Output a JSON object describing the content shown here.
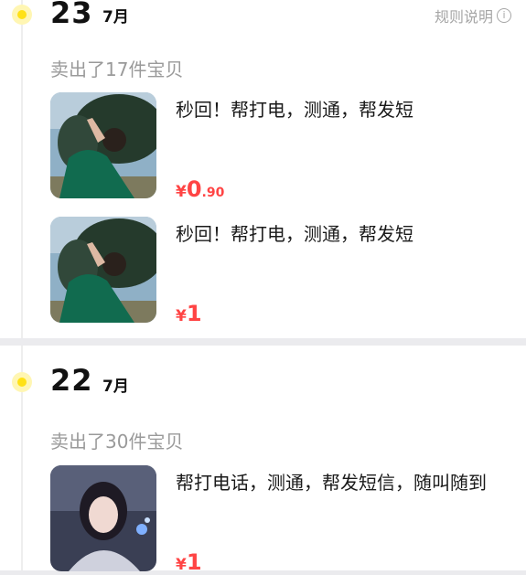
{
  "groups": [
    {
      "day": "23",
      "month": "7月",
      "rules_label": "规则说明",
      "sold_text": "卖出了17件宝贝",
      "items": [
        {
          "title": "秒回！帮打电，测通，帮发短",
          "price_currency": "¥",
          "price_int": "0",
          "price_dec": ".90",
          "image": "woman-green-sweater-photo"
        },
        {
          "title": "秒回！帮打电，测通，帮发短",
          "price_currency": "¥",
          "price_int": "1",
          "price_dec": "",
          "image": "woman-green-sweater-photo"
        }
      ]
    },
    {
      "day": "22",
      "month": "7月",
      "sold_text": "卖出了30件宝贝",
      "items": [
        {
          "title": "帮打电话，测通，帮发短信，随叫随到",
          "price_currency": "¥",
          "price_int": "1",
          "price_dec": "",
          "image": "anime-woman-illustration"
        }
      ]
    }
  ],
  "colors": {
    "accent_yellow": "#ffe116",
    "price_red": "#ff4444",
    "muted": "#9a9a9a"
  },
  "icons": {
    "rules": "info-circle-icon"
  }
}
